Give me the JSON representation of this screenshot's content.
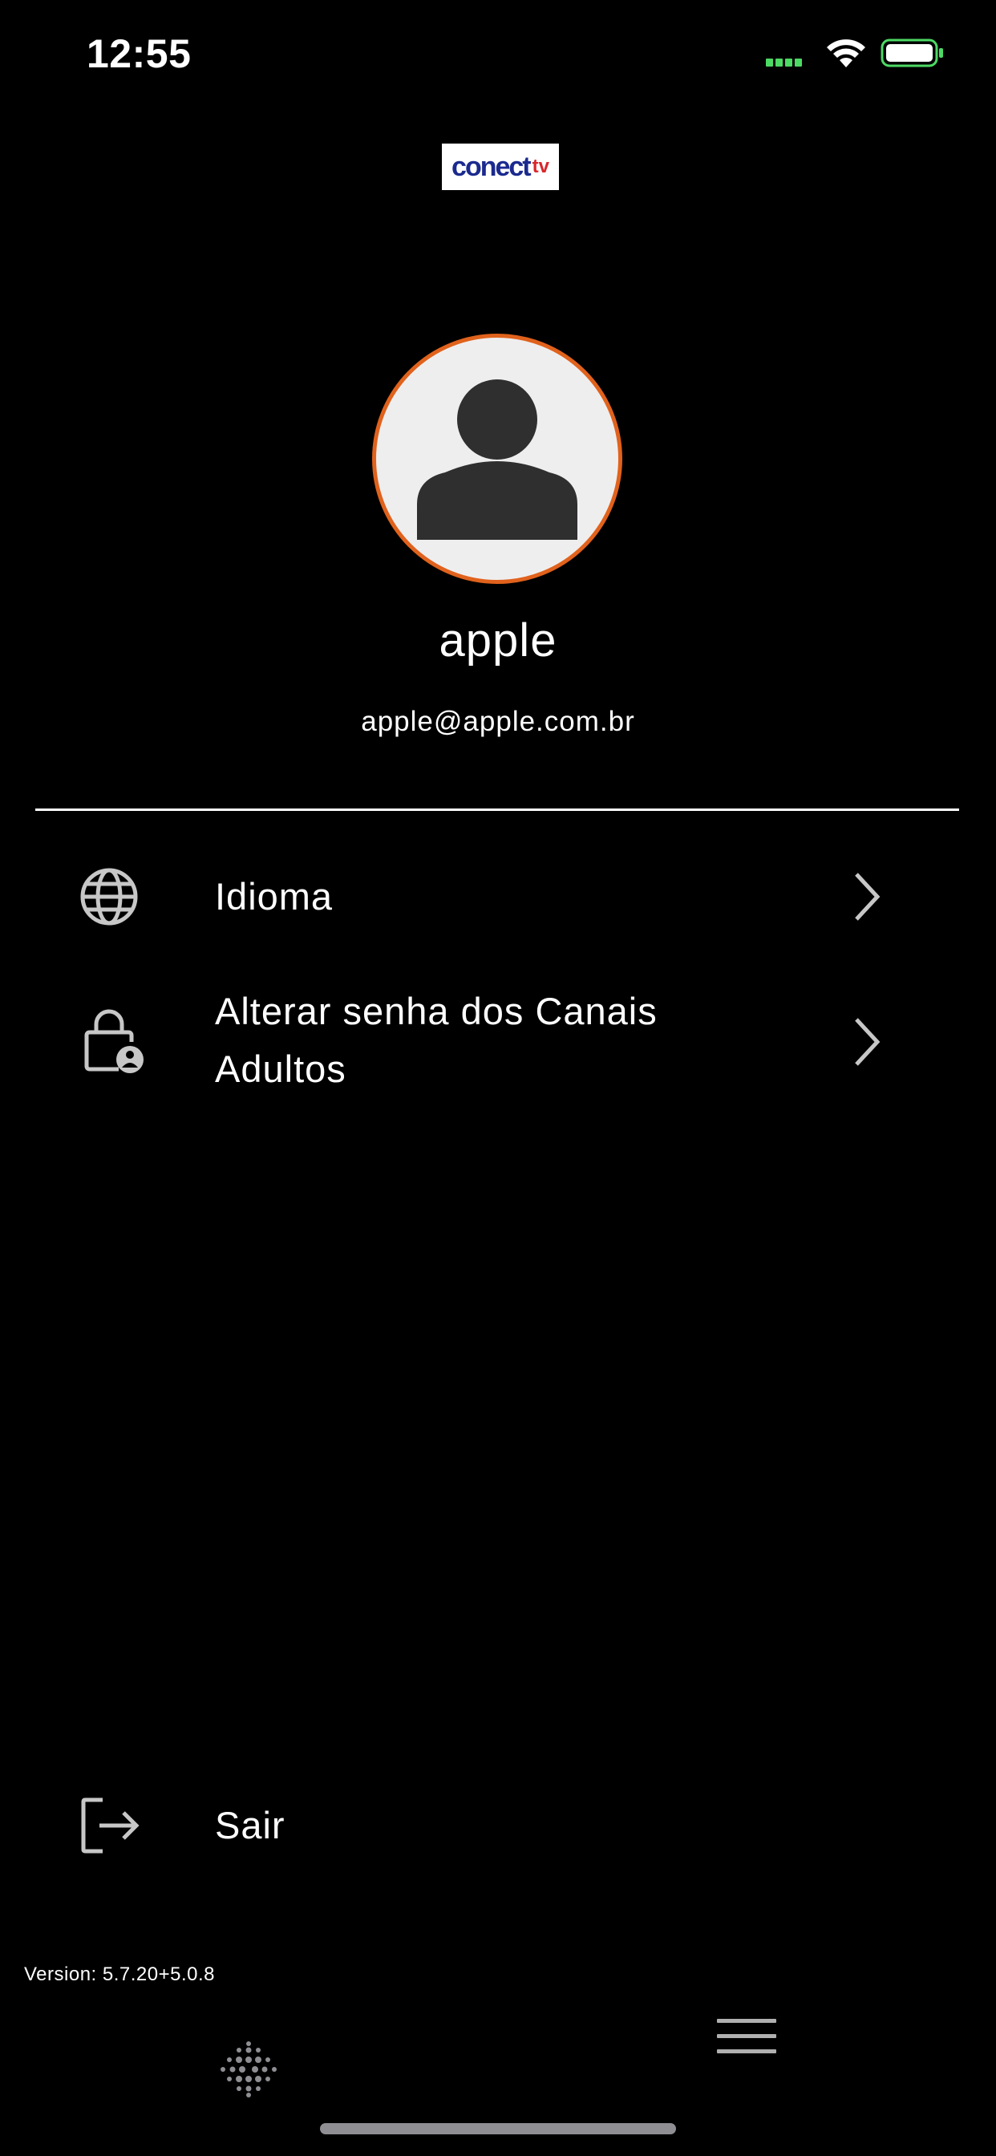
{
  "status_bar": {
    "time": "12:55"
  },
  "logo": {
    "text_main": "conect",
    "text_accent": "tv"
  },
  "profile": {
    "name": "apple",
    "email": "apple@apple.com.br"
  },
  "menu": {
    "items": [
      {
        "label": "Idioma",
        "icon": "globe-icon"
      },
      {
        "label_line1": "Alterar senha dos Canais",
        "label_line2": "Adultos",
        "icon": "lock-user-icon"
      }
    ],
    "logout_label": "Sair"
  },
  "footer": {
    "version": "Version: 5.7.20+5.0.8"
  },
  "colors": {
    "background": "#000000",
    "avatar_border": "#e0621c",
    "signal": "#4cd964",
    "icon_gray": "#c7c7c7"
  }
}
